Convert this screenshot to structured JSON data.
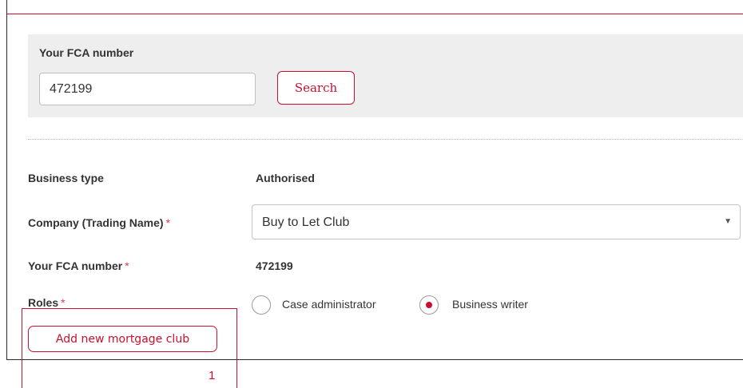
{
  "colors": {
    "accent": "#c8102e",
    "panel_bg": "#eeeeee",
    "text": "#333333"
  },
  "fca_search": {
    "label": "Your FCA number",
    "input_value": "472199",
    "search_label": "Search"
  },
  "details": {
    "business_type_label": "Business type",
    "business_type_value": "Authorised",
    "company_label": "Company (Trading Name)",
    "company_selected": "Buy to Let Club",
    "fca_label": "Your FCA number",
    "fca_value": "472199",
    "roles_label": "Roles",
    "required_marker": "*",
    "roles": [
      {
        "label": "Case administrator",
        "checked": false
      },
      {
        "label": "Business writer",
        "checked": true
      }
    ]
  },
  "actions": {
    "add_club_label": "Add new mortgage club"
  },
  "annotation": {
    "number": "1"
  },
  "icons": {
    "select_caret": "caret-down-icon"
  }
}
